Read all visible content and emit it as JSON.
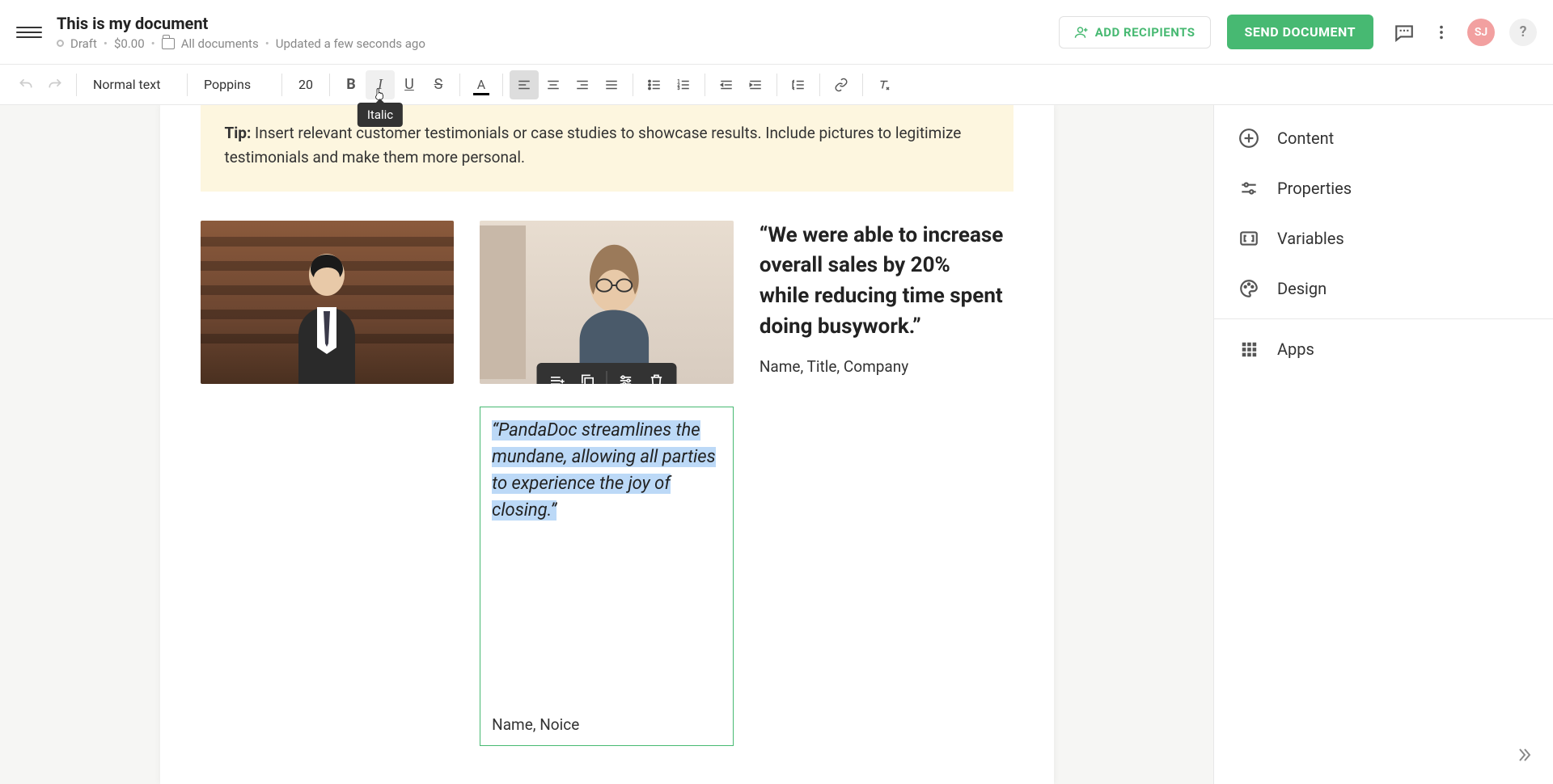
{
  "header": {
    "title": "This is my document",
    "status": "Draft",
    "price": "$0.00",
    "folder": "All documents",
    "updated": "Updated a few seconds ago",
    "add_recipients": "ADD RECIPIENTS",
    "send": "SEND DOCUMENT",
    "avatar": "SJ",
    "help": "?"
  },
  "toolbar": {
    "style": "Normal text",
    "font": "Poppins",
    "size": "20",
    "tooltip_italic": "Italic"
  },
  "tip": {
    "label": "Tip:",
    "text_a": " Insert relevant customer testimonials or case studies to ",
    "text_b": "showcase results. Include pictures to legitimize testimonials and make them more personal."
  },
  "quote1": "“We were able to increase overall sales by 20% while reducing time spent doing busywork.”",
  "byline1": "Name, Title, Company",
  "quote2_a": "“PandaDoc streamlines the",
  "quote2_b": "mundane, allowing all parties",
  "quote2_c": "to experience the joy of",
  "quote2_d": "closing.”",
  "byline2": "Name, Noice",
  "rpanel": {
    "content": "Content",
    "properties": "Properties",
    "variables": "Variables",
    "design": "Design",
    "apps": "Apps"
  }
}
